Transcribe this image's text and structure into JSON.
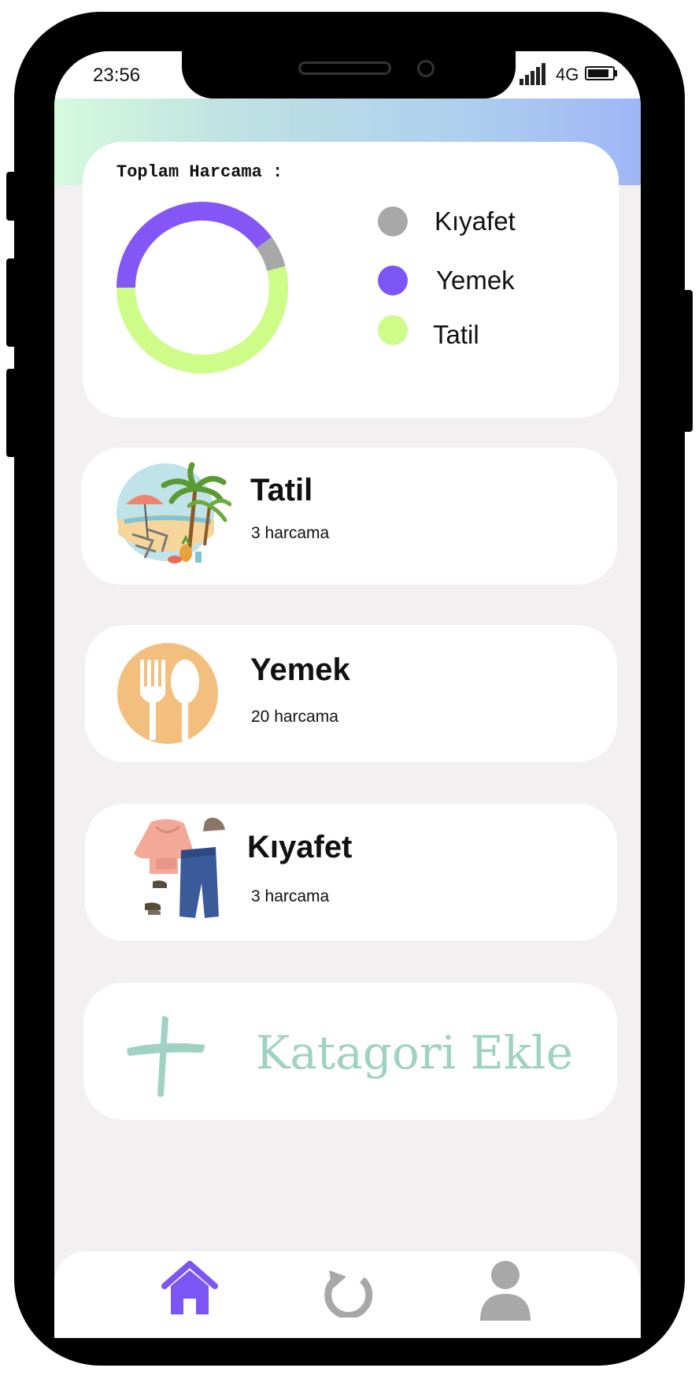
{
  "status_bar": {
    "time": "23:56",
    "network": "4G"
  },
  "summary": {
    "title": "Toplam Harcama :",
    "legend": [
      {
        "label": "Kıyafet",
        "color": "#a8a8a8"
      },
      {
        "label": "Yemek",
        "color": "#7c55f5"
      },
      {
        "label": "Tatil",
        "color": "#cdfd88"
      }
    ]
  },
  "chart_data": {
    "type": "pie",
    "style": "donut",
    "labels": [
      "Yemek",
      "Kıyafet",
      "Tatil"
    ],
    "values": [
      0.4,
      0.06,
      0.54
    ],
    "colors": [
      "#8556f6",
      "#a8a8a8",
      "#cdfd88"
    ]
  },
  "categories": [
    {
      "title": "Tatil",
      "count": "3 harcama",
      "icon": "beach-icon"
    },
    {
      "title": "Yemek",
      "count": "20 harcama",
      "icon": "fork-spoon-icon"
    },
    {
      "title": "Kıyafet",
      "count": "3 harcama",
      "icon": "clothes-icon"
    }
  ],
  "add_category": {
    "label": "Katagori Ekle",
    "icon": "plus-icon",
    "color": "#9fd2c3"
  },
  "bottom_nav": [
    {
      "name": "home",
      "icon": "home-icon",
      "active": true,
      "color": "#7c55f5"
    },
    {
      "name": "refresh",
      "icon": "refresh-icon",
      "active": false,
      "color": "#a8a8a8"
    },
    {
      "name": "profile",
      "icon": "user-icon",
      "active": false,
      "color": "#a8a8a8"
    }
  ]
}
